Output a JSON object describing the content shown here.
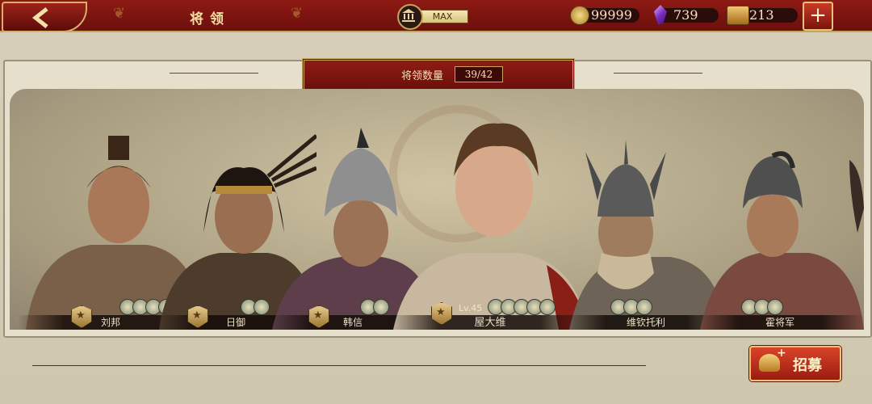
{
  "header": {
    "title": "将领",
    "capital_label": "MAX"
  },
  "resources": [
    {
      "name": "gold",
      "icon": "gold-coin-icon",
      "value": "99999"
    },
    {
      "name": "gem",
      "icon": "purple-gem-icon",
      "value": "739"
    },
    {
      "name": "ticket",
      "icon": "recruit-ticket-icon",
      "value": "213"
    }
  ],
  "roster": {
    "count_label": "将领数量",
    "count_value": "39/42"
  },
  "heroes": [
    {
      "name": "刘邦",
      "level": "",
      "color": "#5a4636"
    },
    {
      "name": "日御",
      "level": "",
      "color": "#4a3a2a"
    },
    {
      "name": "韩信",
      "level": "",
      "color": "#5d4a4a"
    },
    {
      "name": "屋大维",
      "level": "Lv.45",
      "color": "#c9b8a0"
    },
    {
      "name": "维钦托利",
      "level": "",
      "color": "#6d6356"
    },
    {
      "name": "霍将军",
      "level": "",
      "color": "#6e4a40"
    }
  ],
  "actions": {
    "recruit_label": "招募"
  },
  "colors": {
    "banner_red": "#8e1a14",
    "gold_trim": "#c7a25a",
    "parchment": "#d7cfb9"
  }
}
